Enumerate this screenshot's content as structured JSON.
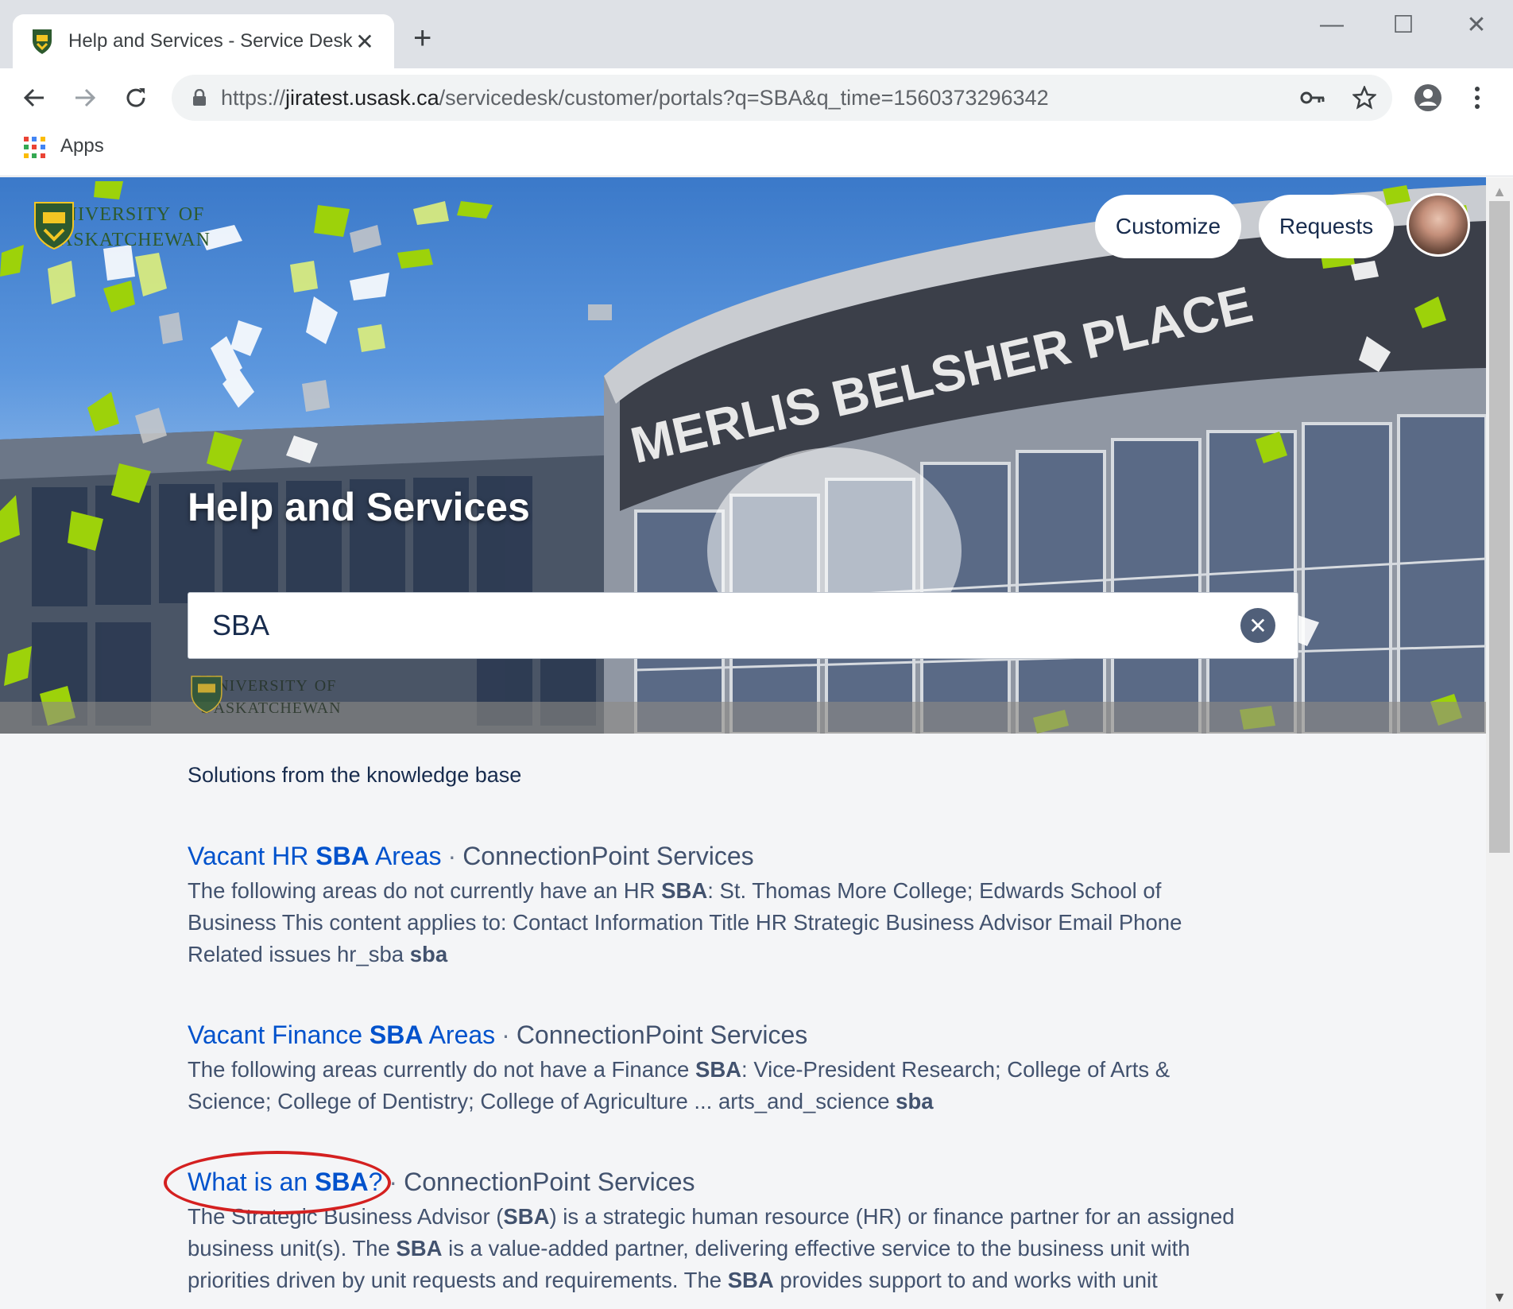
{
  "browser": {
    "tab_title": "Help and Services - Service Desk",
    "tab_close": "✕",
    "new_tab": "+",
    "minimize": "—",
    "maximize": "☐",
    "close": "✕",
    "url_scheme": "https://",
    "url_host": "jiratest.usask.ca",
    "url_path": "/servicedesk/customer/portals?q=SBA&q_time=1560373296342",
    "bookmarks_apps": "Apps"
  },
  "header": {
    "logo_line1": "University of",
    "logo_line2": "Saskatchewan",
    "customize_label": "Customize",
    "requests_label": "Requests",
    "building_sign": "MERLIS BELSHER PLACE",
    "wall_logo_line1": "University of",
    "wall_logo_line2": "Saskatchewan"
  },
  "hero": {
    "title": "Help and Services"
  },
  "search": {
    "value": "SBA"
  },
  "results_section": {
    "label": "Solutions from the knowledge base",
    "separator": "·",
    "items": [
      {
        "title_pre": "Vacant HR ",
        "title_bold": "SBA",
        "title_post": " Areas",
        "source": "ConnectionPoint Services",
        "snip1": "The following areas do not currently have an HR ",
        "snip1_bold": "SBA",
        "snip2": ": St. Thomas More College; Edwards School of Business This content applies to: Contact Information Title HR Strategic Business Advisor Email Phone Related issues hr_sba ",
        "snip2_bold": "sba"
      },
      {
        "title_pre": "Vacant Finance ",
        "title_bold": "SBA",
        "title_post": " Areas",
        "source": "ConnectionPoint Services",
        "snip1": "The following areas currently do not have a Finance ",
        "snip1_bold": "SBA",
        "snip2": ": Vice-President Research; College of Arts & Science; College of Dentistry; College of Agriculture ... arts_and_science ",
        "snip2_bold": "sba"
      },
      {
        "title_pre": "What is an ",
        "title_bold": "SBA",
        "title_post": "?",
        "source": "ConnectionPoint Services",
        "snip1": "The Strategic Business Advisor (",
        "snip1_bold": "SBA",
        "snip2": ") is a strategic human resource (HR) or finance partner for an assigned business unit(s). The ",
        "snip2_bold": "SBA",
        "snip3": " is a value-added partner, delivering effective service to the business unit with priorities driven by unit requests and requirements. The ",
        "snip3_bold": "SBA",
        "snip4": " provides support to and works with unit"
      }
    ]
  },
  "colors": {
    "link": "#0052cc",
    "text": "#172b4d",
    "annotation": "#d42020",
    "usask_green": "#2d5a2e",
    "confetti_green": "#9dd20a"
  },
  "icons": [
    "shield-favicon-icon",
    "lock-icon",
    "back-arrow-icon",
    "forward-arrow-icon",
    "reload-icon",
    "key-icon",
    "star-icon",
    "profile-icon",
    "more-vert-icon",
    "apps-grid-icon",
    "clear-search-icon"
  ]
}
